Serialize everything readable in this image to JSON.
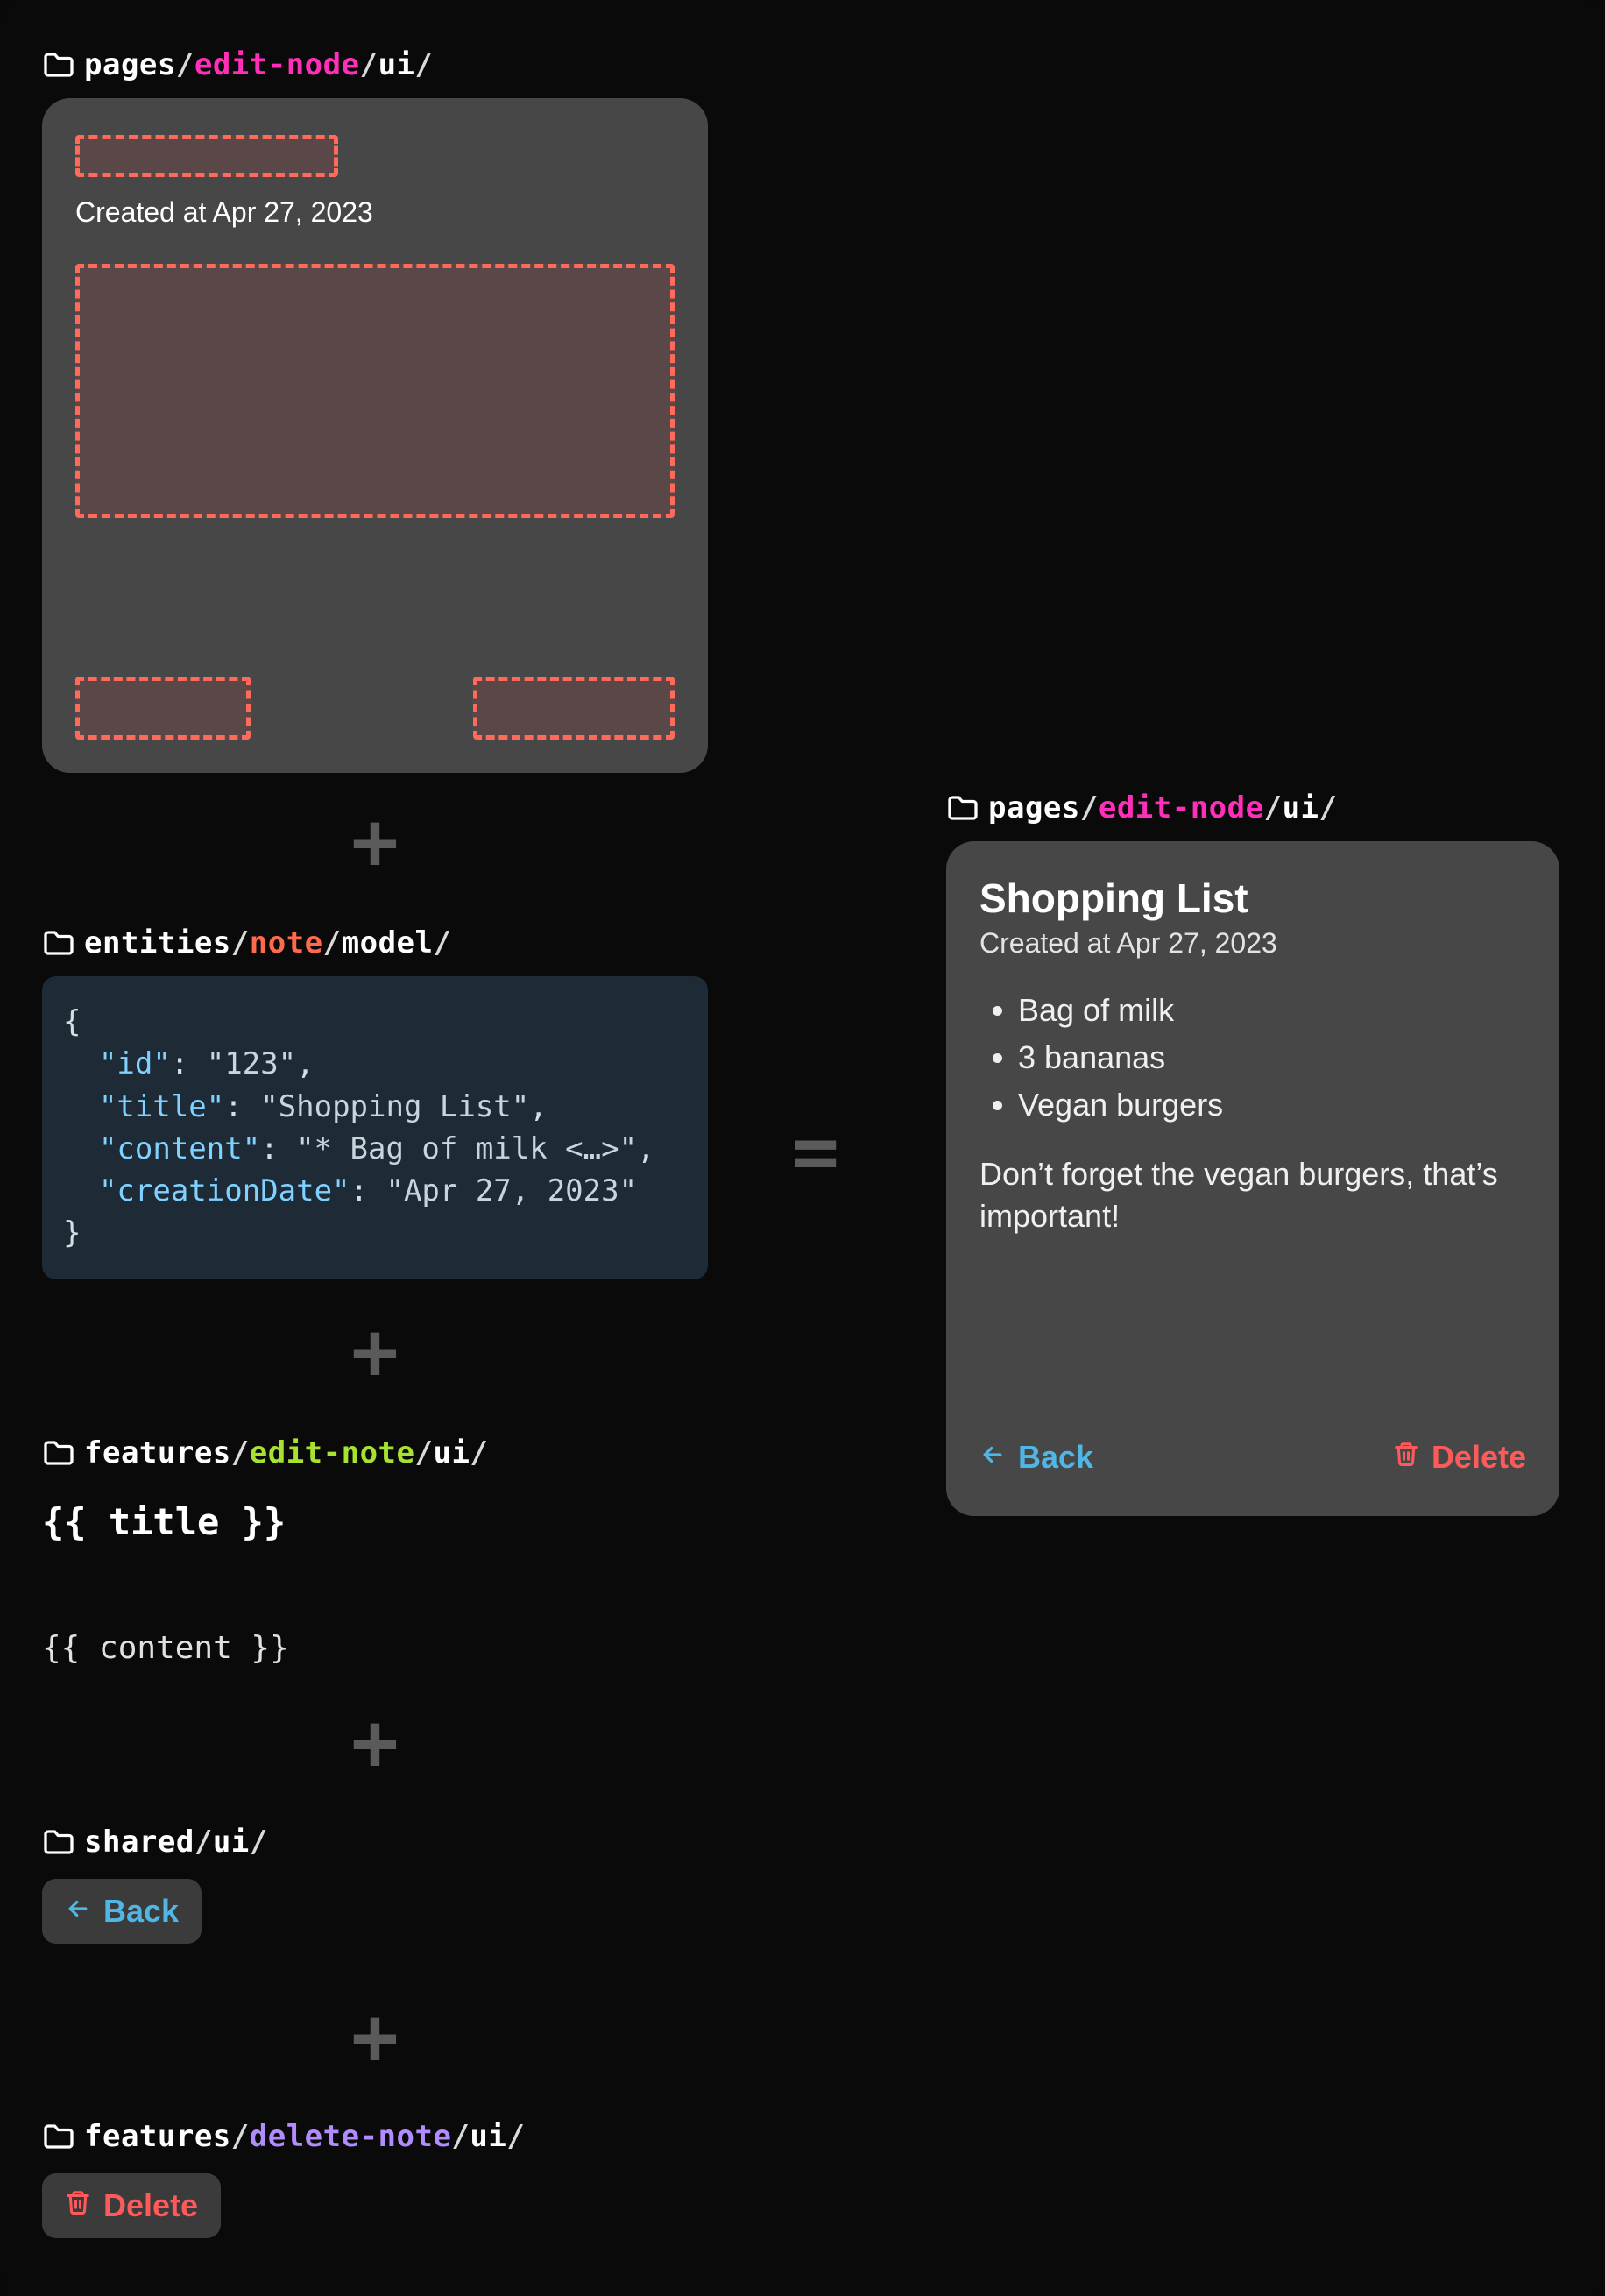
{
  "paths": {
    "pages_left": {
      "seg1": "pages",
      "seg2": "edit-node",
      "seg3": "ui",
      "color2": "pink"
    },
    "entities": {
      "seg1": "entities",
      "seg2": "note",
      "seg3": "model",
      "color2": "orange"
    },
    "features_edit": {
      "seg1": "features",
      "seg2": "edit-note",
      "seg3": "ui",
      "color2": "green"
    },
    "shared_ui": {
      "seg1": "shared",
      "seg2": "ui",
      "seg3": ""
    },
    "features_del": {
      "seg1": "features",
      "seg2": "delete-note",
      "seg3": "ui",
      "color2": "purple"
    },
    "pages_right": {
      "seg1": "pages",
      "seg2": "edit-node",
      "seg3": "ui",
      "color2": "pink"
    }
  },
  "template_card": {
    "created_label": "Created at Apr 27, 2023"
  },
  "json_model": {
    "line_open": "{",
    "k_id": "\"id\"",
    "v_id": "\"123\"",
    "k_title": "\"title\"",
    "v_title": "\"Shopping List\"",
    "k_content": "\"content\"",
    "v_content": "\"* Bag of milk <…>\"",
    "k_date": "\"creationDate\"",
    "v_date": "\"Apr 27, 2023\"",
    "line_close": "}"
  },
  "mustache": {
    "title": "{{ title }}",
    "content": "{{ content }}"
  },
  "buttons": {
    "back": "Back",
    "delete": "Delete"
  },
  "result": {
    "title": "Shopping List",
    "created": "Created at Apr 27, 2023",
    "items": [
      "Bag of milk",
      "3 bananas",
      "Vegan burgers"
    ],
    "paragraph": "Don’t forget the vegan burgers, that’s important!"
  },
  "glyphs": {
    "plus": "+",
    "eq": "="
  }
}
